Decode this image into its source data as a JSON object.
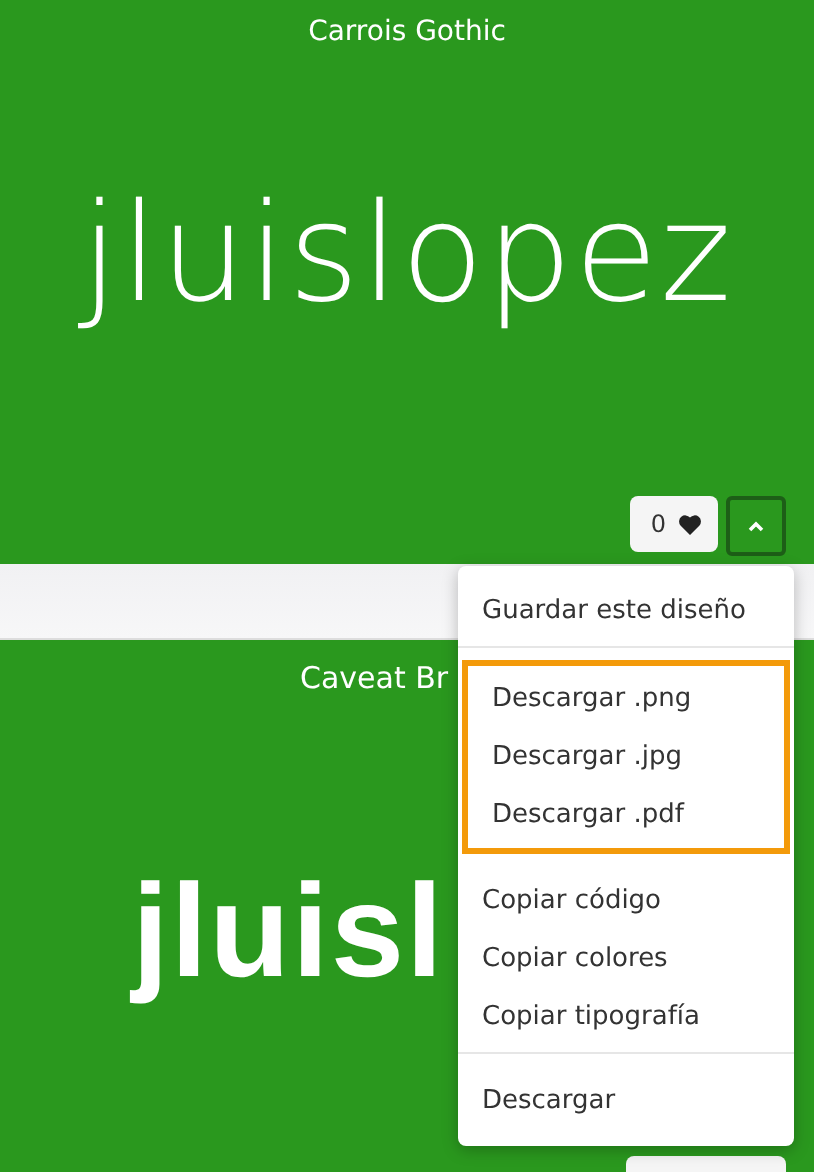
{
  "cards": [
    {
      "font_name": "Carrois Gothic",
      "sample": "jluislopez",
      "likes": "0",
      "menu_expanded": true
    },
    {
      "font_name": "Caveat Br",
      "sample": "jluisl",
      "menu_expanded": false
    }
  ],
  "menu": {
    "groups": [
      {
        "highlighted": false,
        "items": [
          "Guardar este diseño"
        ]
      },
      {
        "highlighted": true,
        "items": [
          "Descargar .png",
          "Descargar .jpg",
          "Descargar .pdf"
        ]
      },
      {
        "highlighted": false,
        "items": [
          "Copiar código",
          "Copiar colores",
          "Copiar tipografía"
        ]
      },
      {
        "highlighted": false,
        "items": [
          "Descargar"
        ]
      }
    ]
  }
}
